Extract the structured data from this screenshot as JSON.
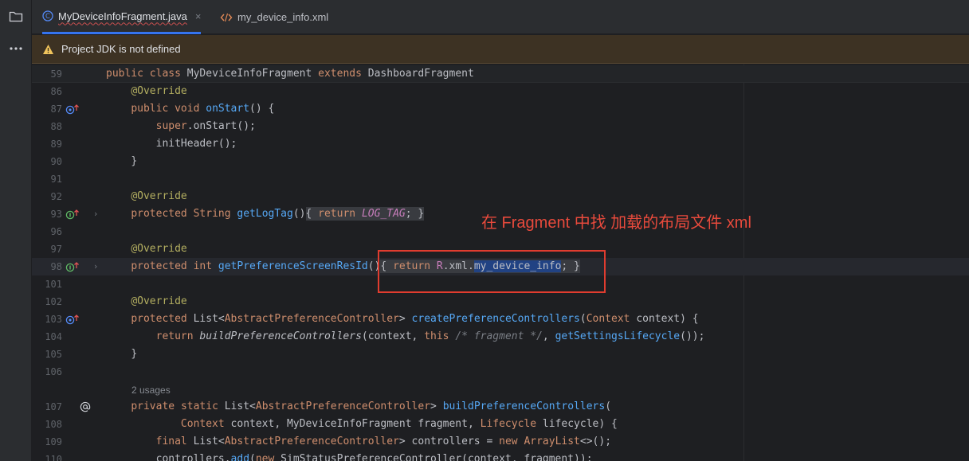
{
  "sidebar": {
    "icons": [
      "folder-icon",
      "more-icon"
    ]
  },
  "tabs": [
    {
      "label": "MyDeviceInfoFragment.java",
      "icon": "class-icon",
      "close": "×",
      "active": true
    },
    {
      "label": "my_device_info.xml",
      "icon": "xml-icon",
      "active": false
    }
  ],
  "banner": {
    "text": "Project JDK is not defined",
    "icon": "warning-icon",
    "color": "#3d3223"
  },
  "editor": {
    "usages_label": "2 usages",
    "line_numbers": [
      "59",
      "86",
      "87",
      "88",
      "89",
      "90",
      "91",
      "92",
      "93",
      "96",
      "97",
      "98",
      "101",
      "102",
      "103",
      "104",
      "105",
      "106",
      "107",
      "108",
      "109",
      "110"
    ],
    "lines": {
      "l59": [
        "public",
        "class",
        "MyDeviceInfoFragment",
        "extends",
        "DashboardFragment"
      ],
      "l86": "@Override",
      "l87": [
        "public",
        "void",
        "onStart",
        "() {"
      ],
      "l88": [
        "super",
        ".onStart();"
      ],
      "l89": "initHeader();",
      "l90": "}",
      "l92": "@Override",
      "l93": [
        "protected",
        "String",
        "getLogTag",
        "()",
        "{ ",
        "return",
        "LOG_TAG",
        ";",
        " }"
      ],
      "l97": "@Override",
      "l98": [
        "protected",
        "int",
        "getPreferenceScreenResId",
        "()",
        "{ ",
        "return",
        "R",
        ".xml.",
        "my_device_info",
        ";",
        " }"
      ],
      "l102": "@Override",
      "l103": [
        "protected",
        "List",
        "<",
        "AbstractPreferenceController",
        "> ",
        "createPreferenceControllers",
        "(",
        "Context",
        " context) {"
      ],
      "l104": [
        "return",
        "buildPreferenceControllers",
        "(context, ",
        "this",
        "/* fragment */",
        ", ",
        "getSettingsLifecycle",
        "());"
      ],
      "l105": "}",
      "l107": [
        "private",
        "static",
        "List",
        "<",
        "AbstractPreferenceController",
        "> ",
        "buildPreferenceControllers",
        "("
      ],
      "l108": [
        "Context",
        " context, MyDeviceInfoFragment fragment, ",
        "Lifecycle",
        " lifecycle) {"
      ],
      "l109": [
        "final",
        "List",
        "<",
        "AbstractPreferenceController",
        "> controllers = ",
        "new",
        "ArrayList",
        "<>();"
      ],
      "l110": [
        "controllers.",
        "add",
        "(",
        "new",
        "SimStatusPreferenceController",
        "(context, fragment));"
      ]
    }
  },
  "annotation": {
    "text": "在 Fragment 中找 加载的布局文件 xml",
    "color": "#e84a3c"
  }
}
